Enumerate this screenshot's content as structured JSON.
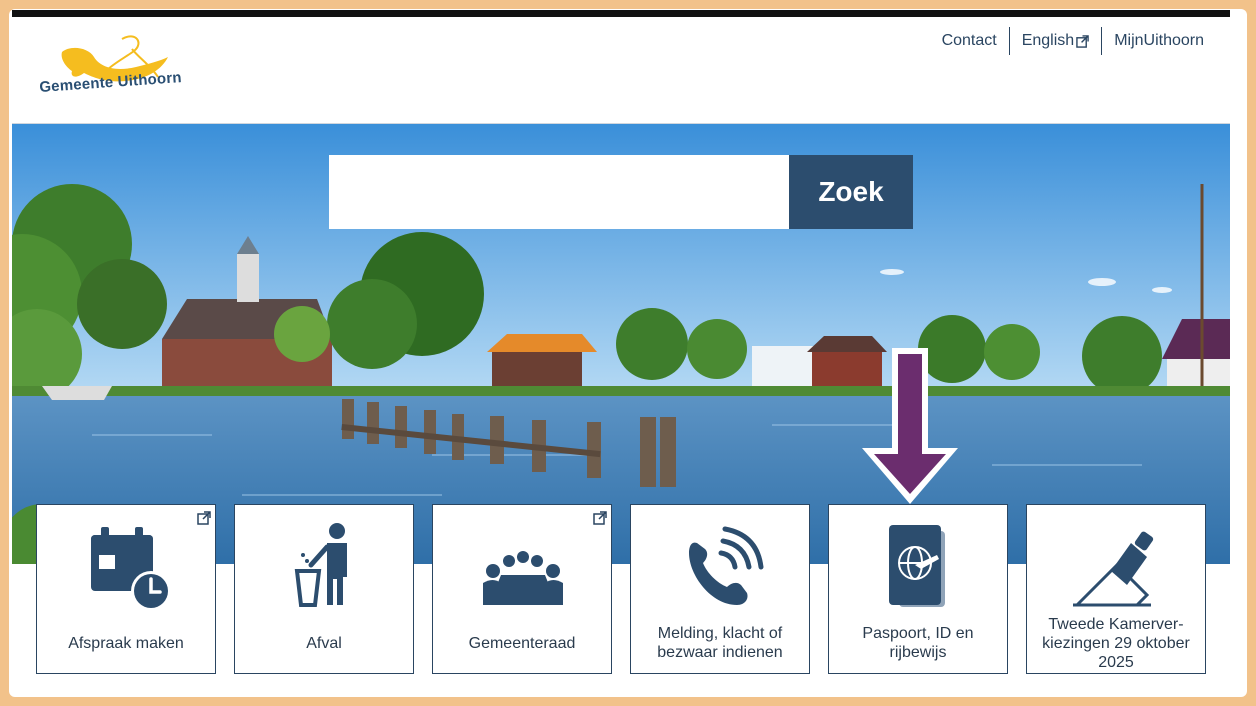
{
  "header": {
    "logo_text": "Gemeente Uithoorn",
    "nav": [
      {
        "label": "Contact",
        "external": false
      },
      {
        "label": "English",
        "external": true
      },
      {
        "label": "MijnUithoorn",
        "external": false
      }
    ]
  },
  "search": {
    "value": "",
    "button_label": "Zoek"
  },
  "tiles": [
    {
      "label": "Afspraak maken",
      "icon": "calendar-clock-icon",
      "external": true
    },
    {
      "label": "Afval",
      "icon": "waste-bin-icon",
      "external": false
    },
    {
      "label": "Gemeenteraad",
      "icon": "council-meeting-icon",
      "external": true
    },
    {
      "label": "Melding, klacht of bezwaar indienen",
      "icon": "phone-icon",
      "external": false
    },
    {
      "label": "Paspoort, ID en rijbewijs",
      "icon": "passport-icon",
      "external": false
    },
    {
      "label": "Tweede Kamerver- kiezingen 29 oktober 2025",
      "icon": "ballot-box-icon",
      "external": false
    }
  ],
  "colors": {
    "frame": "#f2c28a",
    "brand_blue": "#2c4d6e",
    "arrow_purple": "#6b2d6e",
    "logo_yellow": "#f5bd1f"
  }
}
